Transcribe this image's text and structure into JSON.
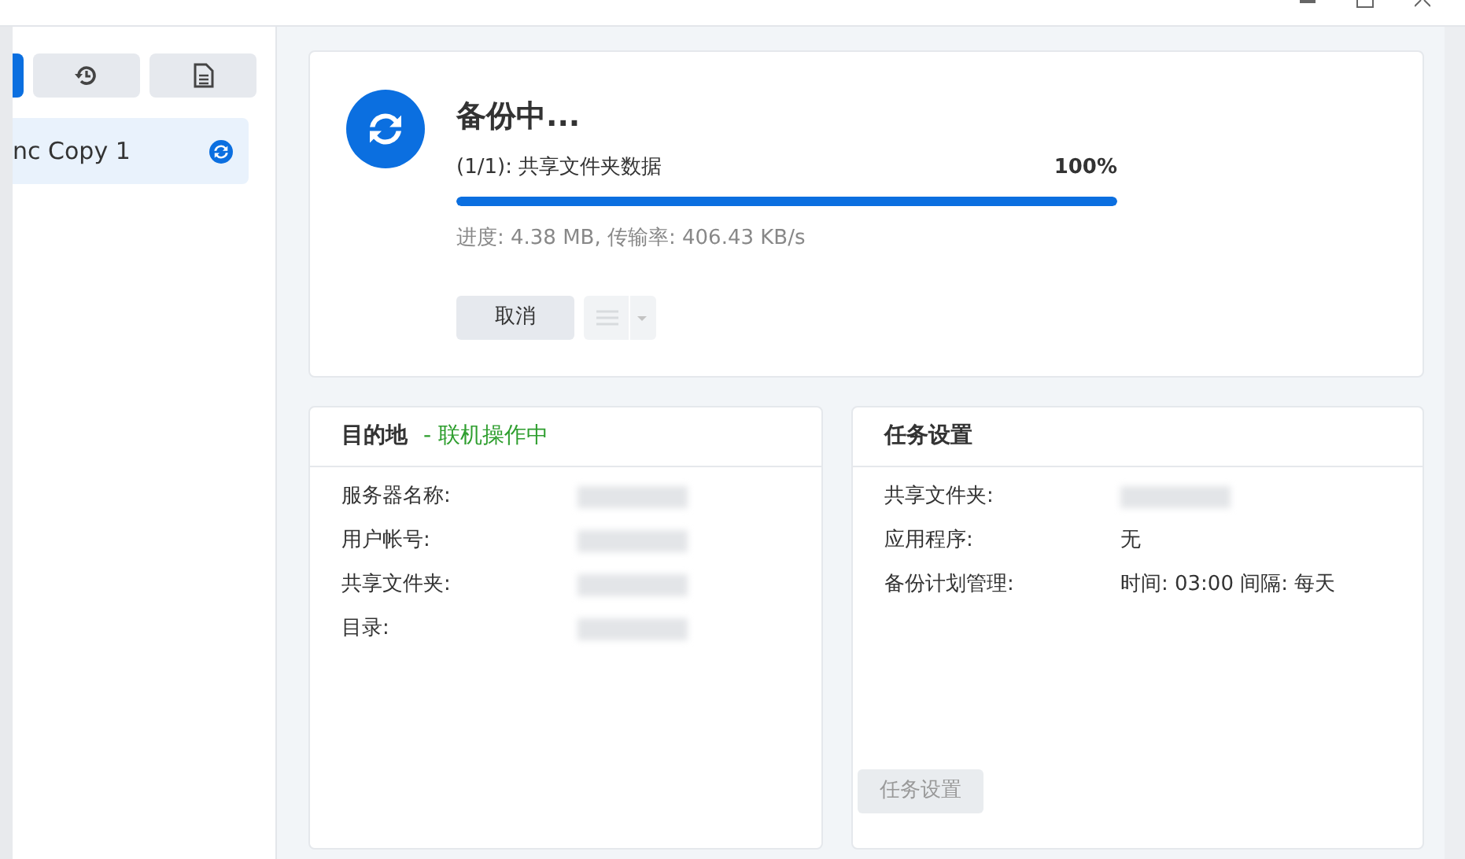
{
  "sidebar": {
    "tabs": [
      {
        "kind": "blank",
        "selected": true
      },
      {
        "kind": "history",
        "selected": false
      },
      {
        "kind": "log",
        "selected": false
      }
    ],
    "tasks": [
      {
        "label": "nc Copy 1",
        "selected": true,
        "syncing": true
      }
    ]
  },
  "progress": {
    "title": "备份中...",
    "step": "(1/1): 共享文件夹数据",
    "percent": "100%",
    "level": 1,
    "detail": "进度: 4.38 MB, 传输率: 406.43 KB/s",
    "cancel_button": "取消",
    "menu_disabled": true
  },
  "destination": {
    "title": "目的地",
    "status": "- 联机操作中",
    "fields": [
      {
        "label": "服务器名称:"
      },
      {
        "label": "用户帐号:"
      },
      {
        "label": "共享文件夹:"
      },
      {
        "label": "目录:"
      }
    ]
  },
  "task_settings": {
    "title": "任务设置",
    "fields": [
      {
        "label": "共享文件夹:"
      },
      {
        "label": "应用程序:",
        "value": "无"
      },
      {
        "label": "备份计划管理:",
        "value": "时间: 03:00 间隔: 每天"
      }
    ],
    "button": "任务设置",
    "button_disabled": true
  }
}
